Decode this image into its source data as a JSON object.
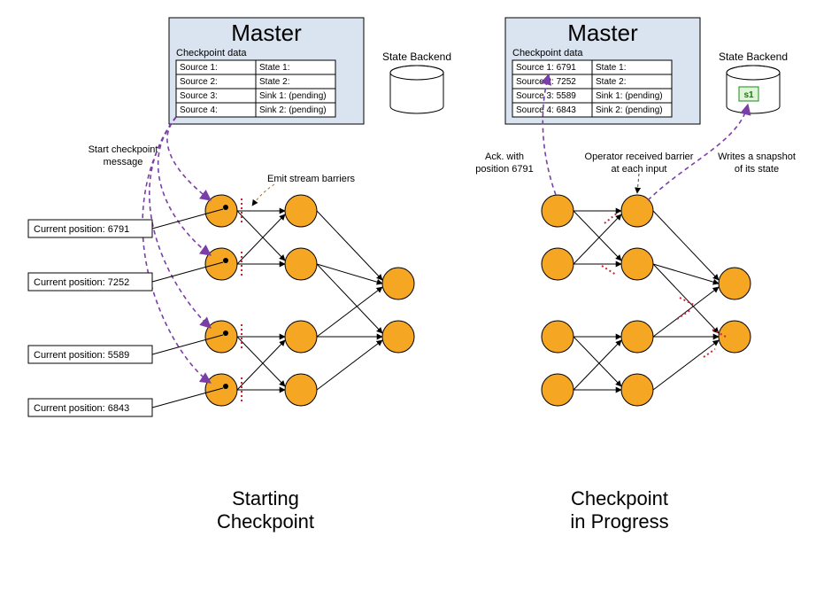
{
  "left": {
    "master_title": "Master",
    "table_title": "Checkpoint data",
    "rows": [
      [
        "Source 1:",
        "State 1:"
      ],
      [
        "Source 2:",
        "State 2:"
      ],
      [
        "Source 3:",
        "Sink 1: (pending)"
      ],
      [
        "Source 4:",
        "Sink 2: (pending)"
      ]
    ],
    "state_backend": "State Backend",
    "start_msg_l1": "Start checkpoint",
    "start_msg_l2": "message",
    "emit_barriers": "Emit stream barriers",
    "positions": [
      "Current position: 6791",
      "Current position: 7252",
      "Current position: 5589",
      "Current position: 6843"
    ],
    "phase_l1": "Starting",
    "phase_l2": "Checkpoint"
  },
  "right": {
    "master_title": "Master",
    "table_title": "Checkpoint data",
    "rows": [
      [
        "Source 1: 6791",
        "State 1:"
      ],
      [
        "Source 2: 7252",
        "State 2:"
      ],
      [
        "Source 3: 5589",
        "Sink 1: (pending)"
      ],
      [
        "Source 4: 6843",
        "Sink 2: (pending)"
      ]
    ],
    "state_backend": "State Backend",
    "ack_l1": "Ack. with",
    "ack_l2": "position 6791",
    "op_l1": "Operator received barrier",
    "op_l2": "at each input",
    "snap_l1": "Writes a snapshot",
    "snap_l2": "of its state",
    "snap_label": "s1",
    "phase_l1": "Checkpoint",
    "phase_l2": "in Progress"
  }
}
